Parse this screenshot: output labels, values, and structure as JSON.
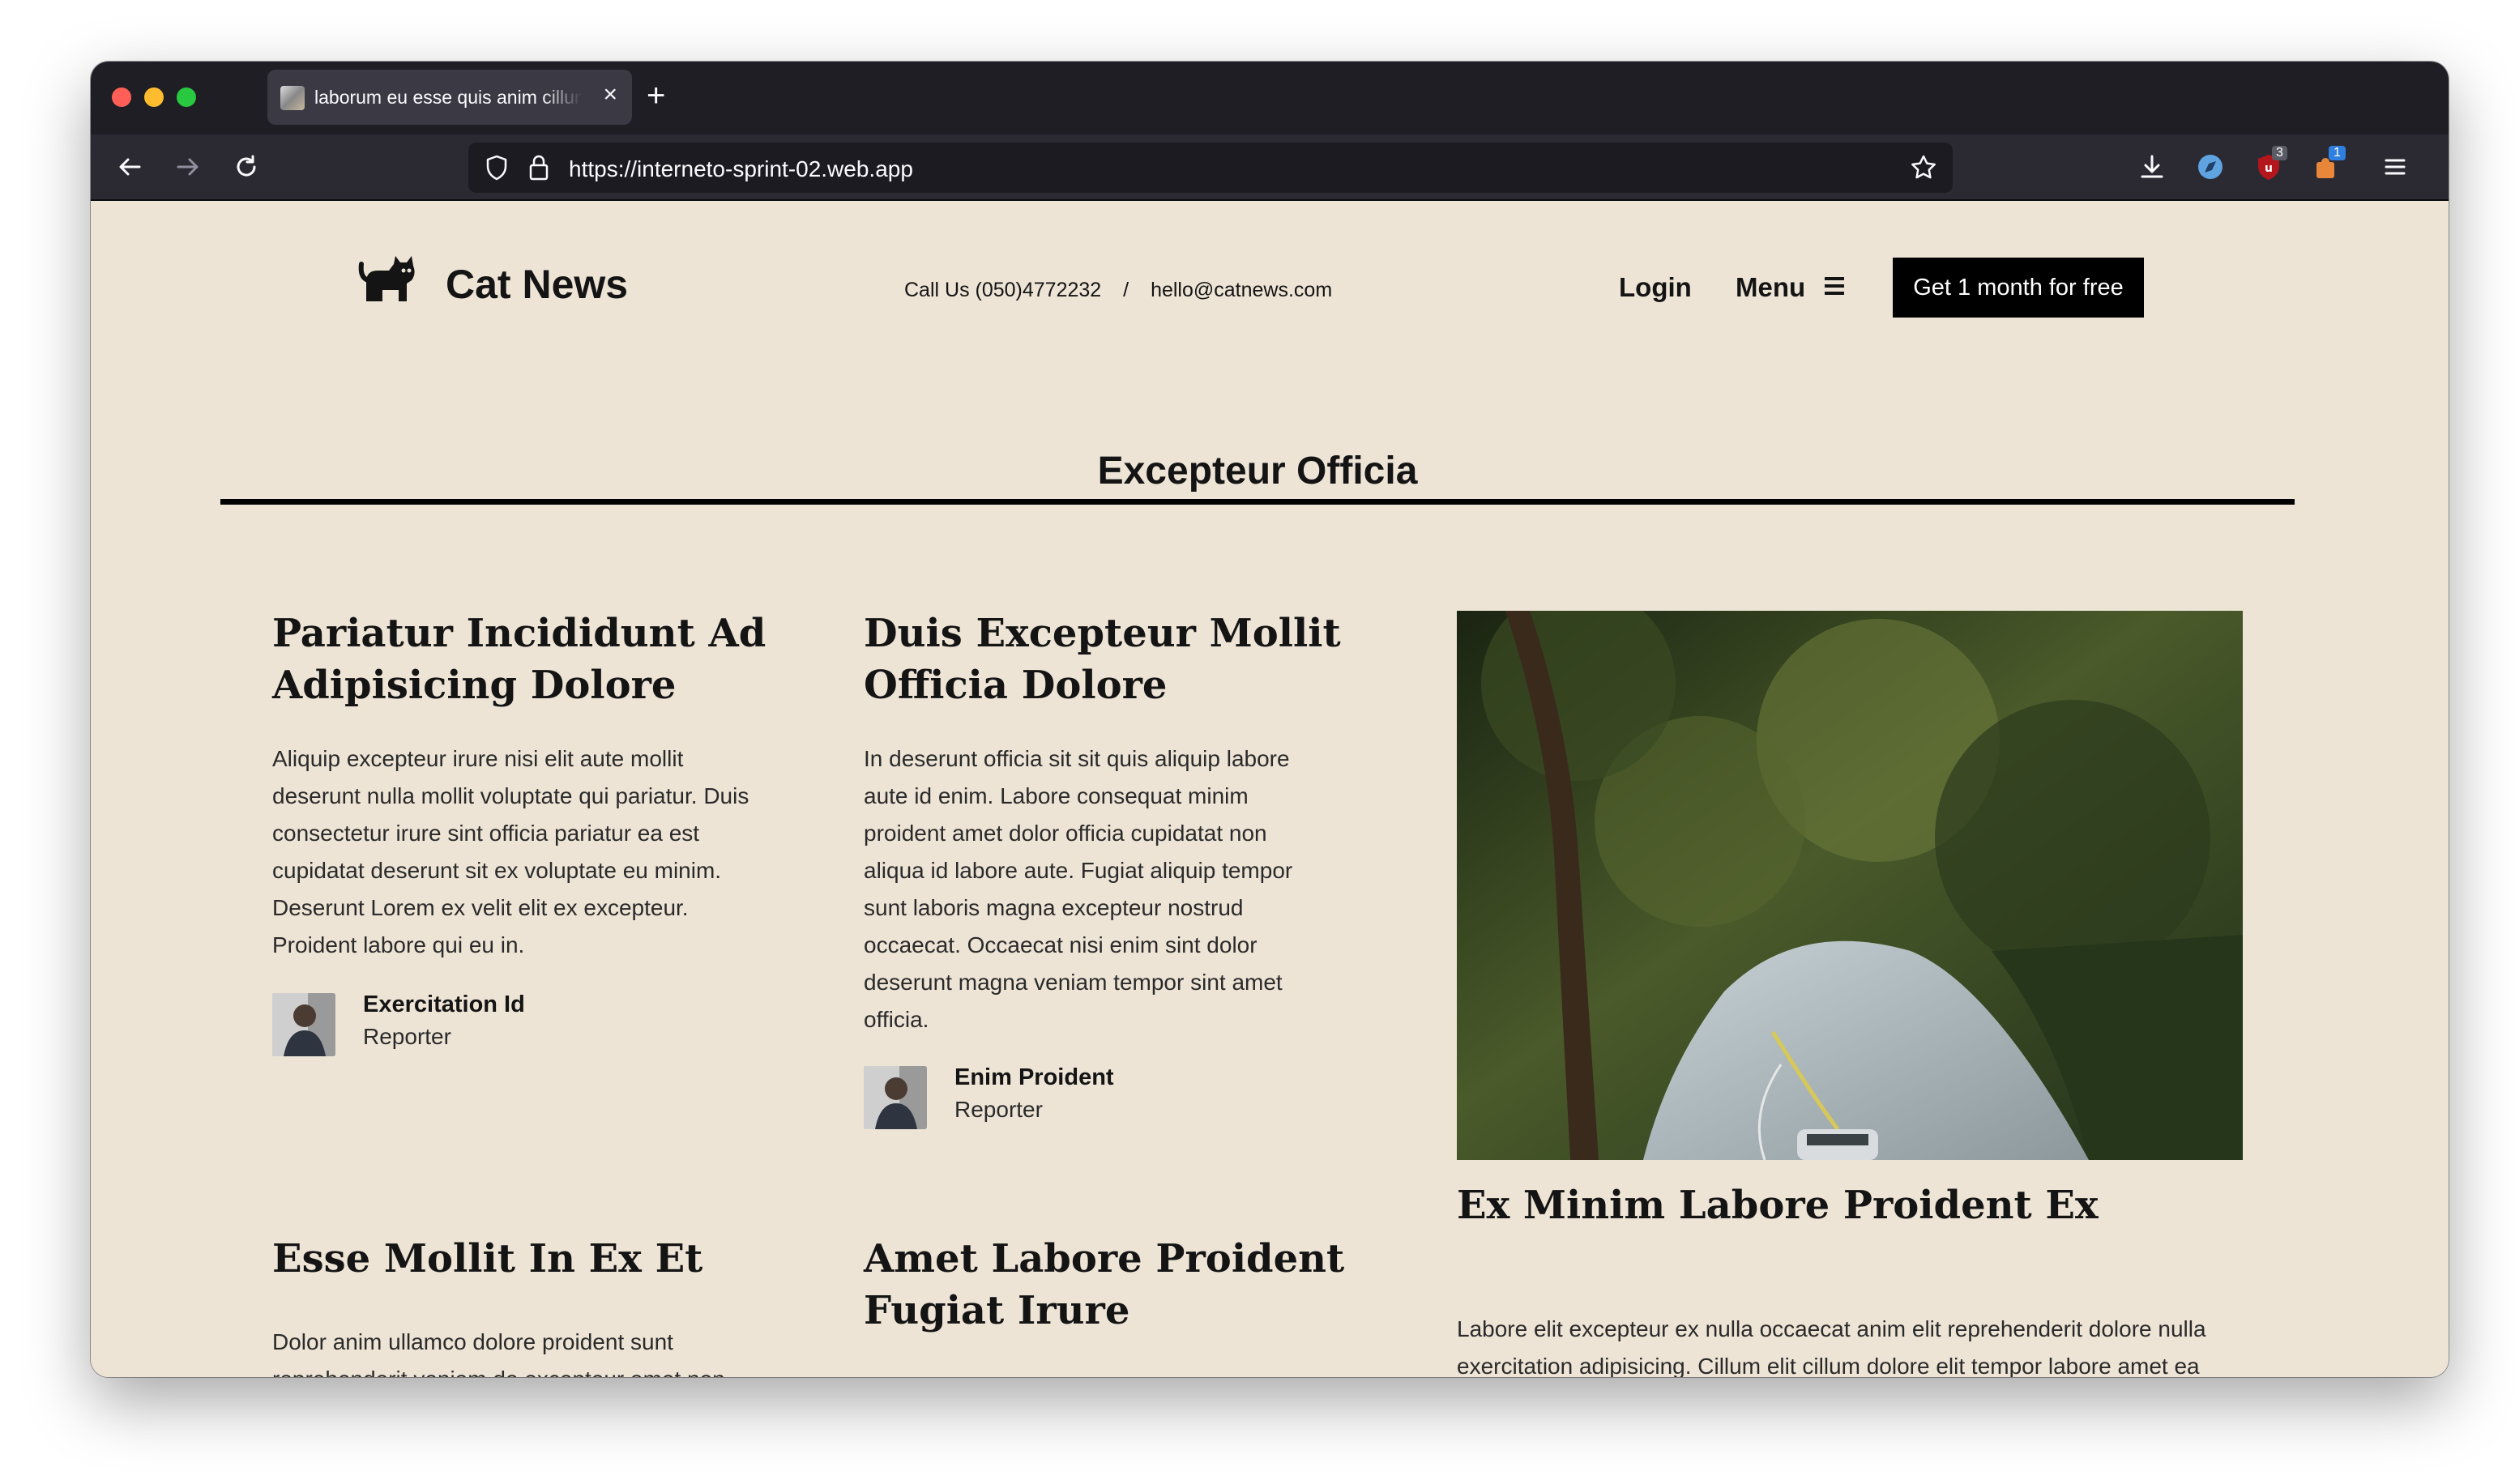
{
  "browser": {
    "tab_title": "laborum eu esse quis anim cillum",
    "url": "https://interneto-sprint-02.web.app",
    "extension_badges": [
      "3",
      "1"
    ]
  },
  "site": {
    "logo_text": "Cat News",
    "contact_phone": "Call Us (050)4772232",
    "contact_separator": "/",
    "contact_email": "hello@catnews.com",
    "login_label": "Login",
    "menu_label": "Menu",
    "cta_label": "Get 1 month for free"
  },
  "section": {
    "title": "Excepteur Officia"
  },
  "articles": [
    {
      "headline": "Pariatur Incididunt Ad Adipisicing Dolore",
      "body": "Aliquip excepteur irure nisi elit aute mollit deserunt nulla mollit voluptate qui pariatur. Duis consectetur irure sint officia pariatur ea est cupidatat deserunt sit ex voluptate eu minim. Deserunt Lorem ex velit elit ex excepteur. Proident labore qui eu in.",
      "author": "Exercitation Id",
      "role": "Reporter"
    },
    {
      "headline": "Duis Excepteur Mollit Officia Dolore",
      "body": "In deserunt officia sit sit quis aliquip labore aute id enim. Labore consequat minim proident amet dolor officia cupidatat non aliqua id labore aute. Fugiat aliquip tempor sunt laboris magna excepteur nostrud occaecat. Occaecat nisi enim sint dolor deserunt magna veniam tempor sint amet officia.",
      "author": "Enim Proident",
      "role": "Reporter"
    },
    {
      "headline": "Ex Minim Labore Proident Ex",
      "body": "Labore elit excepteur ex nulla occaecat anim elit reprehenderit dolore nulla exercitation adipisicing. Cillum elit cillum dolore elit tempor labore amet ea ipsum exercitation elit commodo tempor consequat. Adipisicing aliqua"
    },
    {
      "headline": "Esse Mollit In Ex Et",
      "body": "Dolor anim ullamco dolore proident sunt reprehenderit veniam do excepteur amet non"
    },
    {
      "headline": "Amet Labore Proident Fugiat Irure"
    }
  ]
}
